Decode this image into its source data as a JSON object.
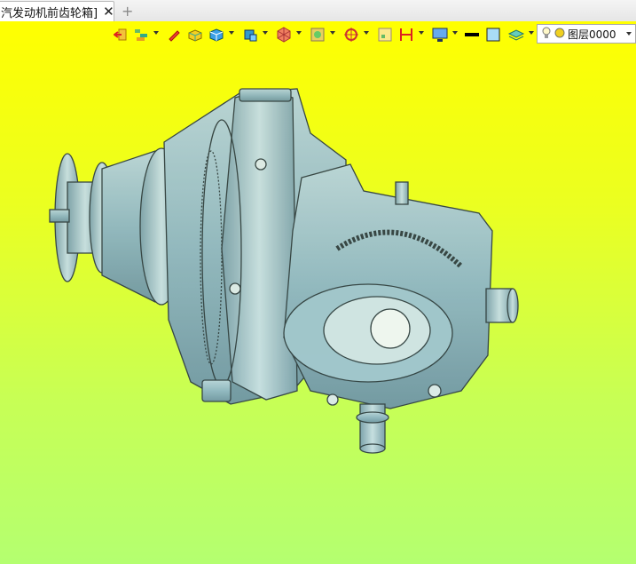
{
  "tab": {
    "title": "汽发动机前齿轮箱]",
    "close_glyph": "✕",
    "add_glyph": "+"
  },
  "toolbar": {
    "icons": [
      "exit-icon",
      "layer-tree-icon",
      "pencil-icon",
      "box-face-icon",
      "cube-icon",
      "cube-view-icon",
      "render-mode-icon",
      "orientation-icon",
      "snap-icon",
      "zoom-fit-icon",
      "measure-icon",
      "display-icon",
      "line-color-icon",
      "fill-color-icon",
      "layer-stack-icon"
    ],
    "layer_select": {
      "value": "图层0000"
    }
  },
  "colors": {
    "viewport_top": "#ffff00",
    "viewport_bottom": "#b4ff70",
    "model": "#8fb6c6",
    "model_edge": "#2f3e46"
  }
}
